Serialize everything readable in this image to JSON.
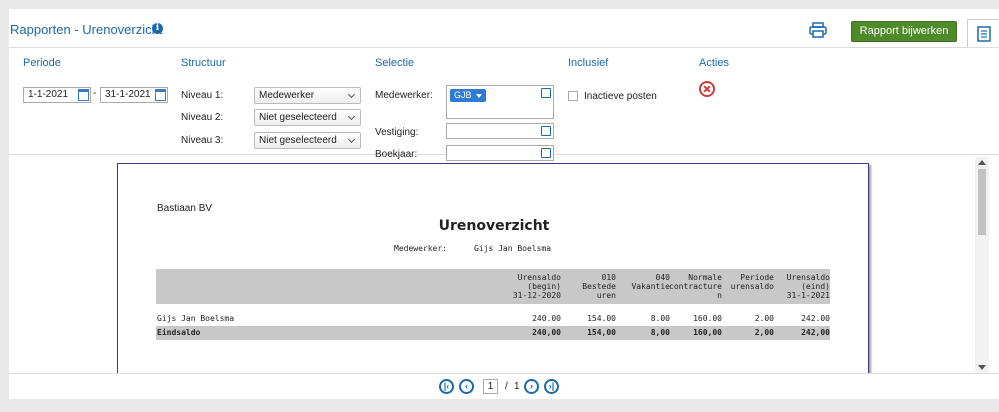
{
  "header": {
    "title": "Rapporten - Urenoverzicht",
    "info_glyph": "i",
    "update_button": "Rapport bijwerken"
  },
  "filters": {
    "periode": {
      "label": "Periode",
      "from": "1-1-2021",
      "sep": "-",
      "to": "31-1-2021"
    },
    "structuur": {
      "label": "Structuur",
      "levels": [
        {
          "label": "Niveau 1:",
          "value": "Medewerker"
        },
        {
          "label": "Niveau 2:",
          "value": "Niet geselecteerd"
        },
        {
          "label": "Niveau 3:",
          "value": "Niet geselecteerd"
        }
      ]
    },
    "selectie": {
      "label": "Selectie",
      "medewerker_label": "Medewerker:",
      "medewerker_chip": "GJB",
      "vestiging_label": "Vestiging:",
      "boekjaar_label": "Boekjaar:"
    },
    "inclusief": {
      "label": "Inclusief",
      "checkbox_label": "Inactieve posten",
      "checked": false
    },
    "acties": {
      "label": "Acties"
    }
  },
  "report": {
    "company": "Bastiaan BV",
    "title": "Urenoverzicht",
    "meta_label": "Medewerker:",
    "meta_value": "Gijs Jan Boelsma",
    "columns": [
      [
        "Urensaldo",
        "(begin)",
        "31-12-2020"
      ],
      [
        "010",
        "Bestede",
        "uren"
      ],
      [
        "040",
        "Vakantie"
      ],
      [
        "Normale",
        "contracture",
        "n"
      ],
      [
        "Periode",
        "urensaldo"
      ],
      [
        "Urensaldo",
        "(eind)",
        "31-1-2021"
      ]
    ],
    "rows": [
      {
        "name": "Gijs Jan Boelsma",
        "values": [
          "240.00",
          "154.00",
          "8.00",
          "160.00",
          "2.00",
          "242.00"
        ]
      }
    ],
    "total": {
      "name": "Eindsaldo",
      "values": [
        "240,00",
        "154,00",
        "8,00",
        "160,00",
        "2,00",
        "242,00"
      ]
    }
  },
  "pager": {
    "current": "1",
    "sep": "/",
    "total": "1"
  },
  "colors": {
    "accent": "#1a6aaa",
    "update_button": "#4f8a2a",
    "close": "#d03a3a"
  }
}
